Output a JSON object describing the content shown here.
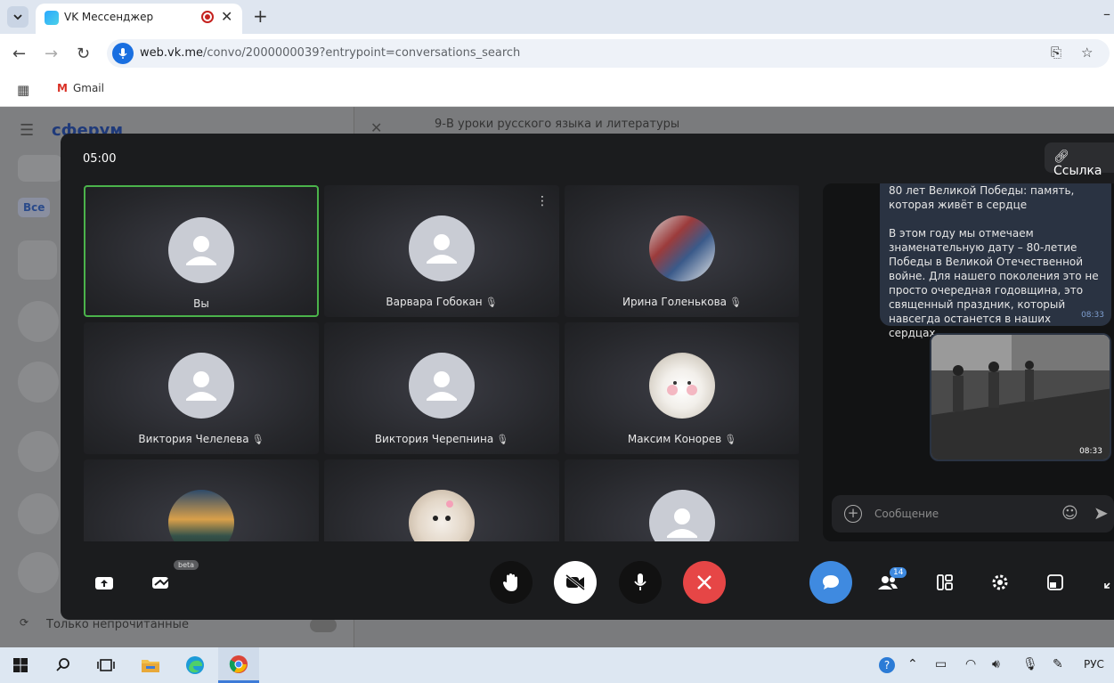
{
  "browser": {
    "tab_title": "VK Мессенджер",
    "url_host": "web.vk.me",
    "url_path": "/convo/2000000039?entrypoint=conversations_search",
    "bookmark_gmail": "Gmail"
  },
  "background_page": {
    "logo": "сферум",
    "filter_chip": "Все",
    "chat_title": "9-В уроки русского языка и литературы",
    "unread_toggle_label": "Только непрочитанные"
  },
  "call": {
    "timer": "05:00",
    "link_button": "Ссылка",
    "participants": [
      {
        "name": "Вы",
        "muted": false,
        "avatar": "placeholder",
        "self": true
      },
      {
        "name": "Варвара Гобокан",
        "muted": true,
        "avatar": "placeholder",
        "self": false
      },
      {
        "name": "Ирина Голенькова",
        "muted": true,
        "avatar": "photo",
        "self": false
      },
      {
        "name": "Виктория Челелева",
        "muted": true,
        "avatar": "placeholder",
        "self": false
      },
      {
        "name": "Виктория Черепнина",
        "muted": true,
        "avatar": "placeholder",
        "self": false
      },
      {
        "name": "Максим Конорев",
        "muted": true,
        "avatar": "cat-photo",
        "self": false
      },
      {
        "name": "",
        "muted": false,
        "avatar": "landscape-photo",
        "self": false
      },
      {
        "name": "",
        "muted": false,
        "avatar": "hamster-photo",
        "self": false
      },
      {
        "name": "",
        "muted": false,
        "avatar": "placeholder",
        "self": false
      }
    ],
    "chat": {
      "message_paragraph_1": "80 лет Великой Победы: память, которая живёт в сердце",
      "message_paragraph_2": "В этом году мы отмечаем знаменательную дату – 80-летие Победы в Великой Отечественной войне. Для нашего поколения это не просто очередная годовщина, это священный праздник, который навсегда останется в наших сердцах.",
      "message_time": "08:33",
      "photo_time": "08:33",
      "input_placeholder": "Сообщение"
    },
    "controls": {
      "beta_label": "beta",
      "participants_count": "14"
    }
  },
  "taskbar": {
    "language": "РУС"
  },
  "colors": {
    "accent_blue": "#3f8ae0",
    "end_call_red": "#e64646",
    "self_border_green": "#4bb34b"
  }
}
